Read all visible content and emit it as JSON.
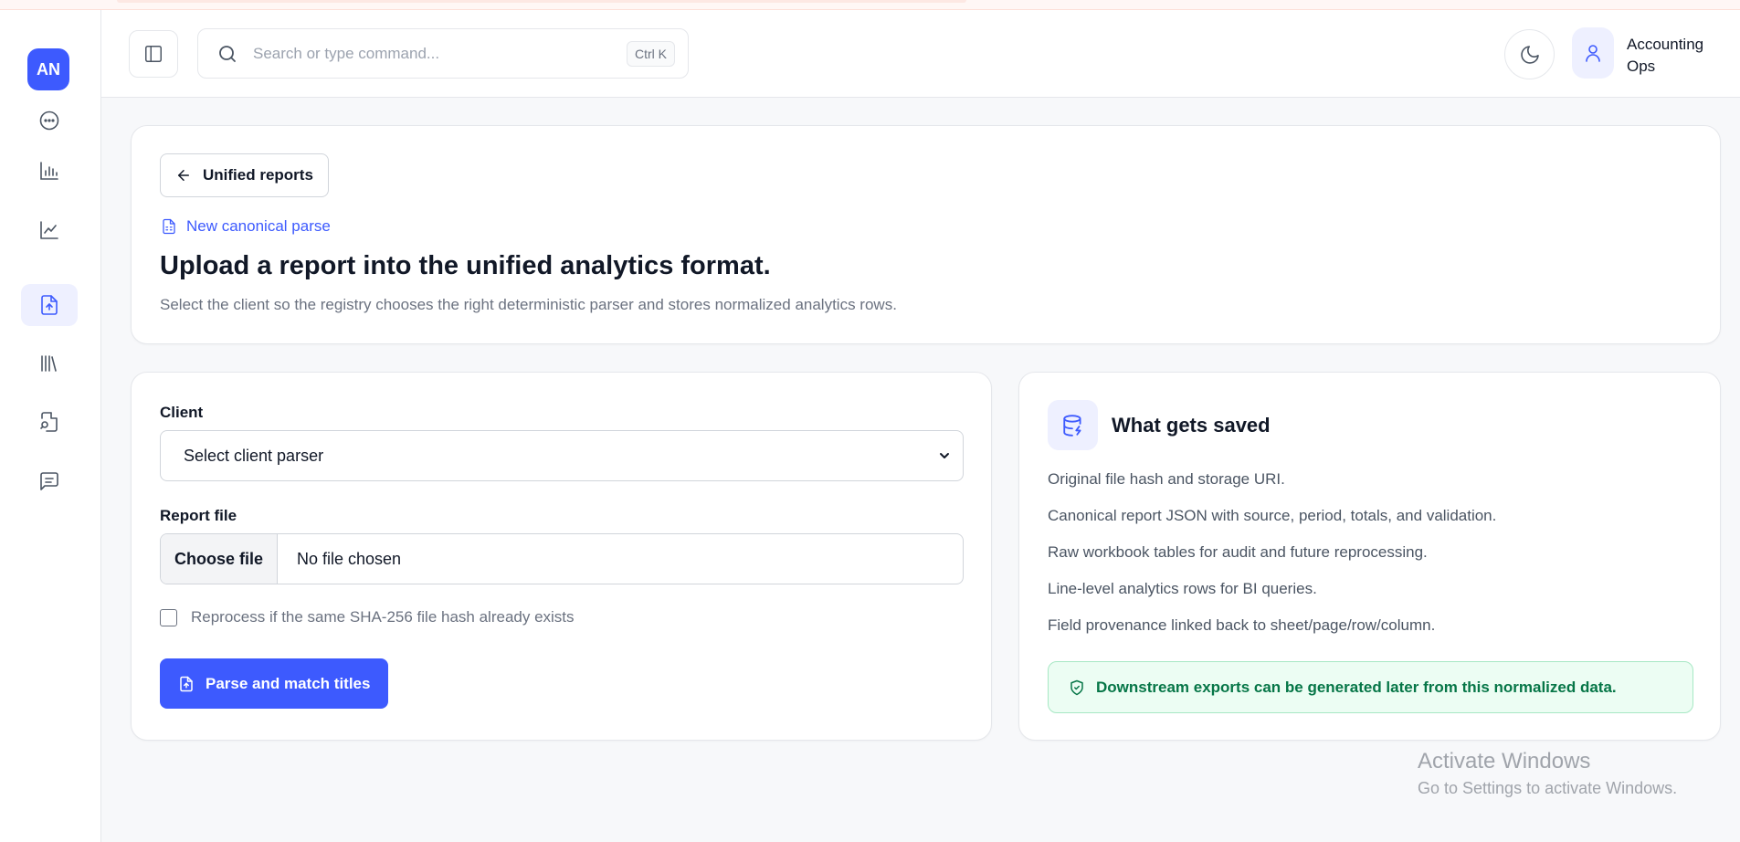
{
  "sidebar": {
    "avatar_initials": "AN",
    "items": [
      {
        "icon": "more-horizontal-icon"
      },
      {
        "icon": "bar-chart-icon"
      },
      {
        "icon": "line-chart-icon"
      },
      {
        "icon": "file-upload-icon",
        "active": true
      },
      {
        "icon": "library-icon"
      },
      {
        "icon": "file-search-icon"
      },
      {
        "icon": "message-icon"
      }
    ]
  },
  "header": {
    "search_placeholder": "Search or type command...",
    "search_shortcut": "Ctrl K",
    "user_name": "Accounting Ops"
  },
  "hero": {
    "back_label": "Unified reports",
    "eyebrow": "New canonical parse",
    "title": "Upload a report into the unified analytics format.",
    "description": "Select the client so the registry chooses the right deterministic parser and stores normalized analytics rows."
  },
  "form": {
    "client_label": "Client",
    "client_value": "Select client parser",
    "file_label": "Report file",
    "choose_file_label": "Choose file",
    "file_status": "No file chosen",
    "reprocess_label": "Reprocess if the same SHA-256 file hash already exists",
    "reprocess_checked": false,
    "submit_label": "Parse and match titles"
  },
  "info": {
    "title": "What gets saved",
    "items": [
      "Original file hash and storage URI.",
      "Canonical report JSON with source, period, totals, and validation.",
      "Raw workbook tables for audit and future reprocessing.",
      "Line-level analytics rows for BI queries.",
      "Field provenance linked back to sheet/page/row/column."
    ],
    "notice": "Downstream exports can be generated later from this normalized data."
  },
  "watermark": {
    "title": "Activate Windows",
    "subtitle": "Go to Settings to activate Windows."
  },
  "colors": {
    "accent": "#3d5afe",
    "success_text": "#067647",
    "success_bg": "#ecfdf3"
  }
}
